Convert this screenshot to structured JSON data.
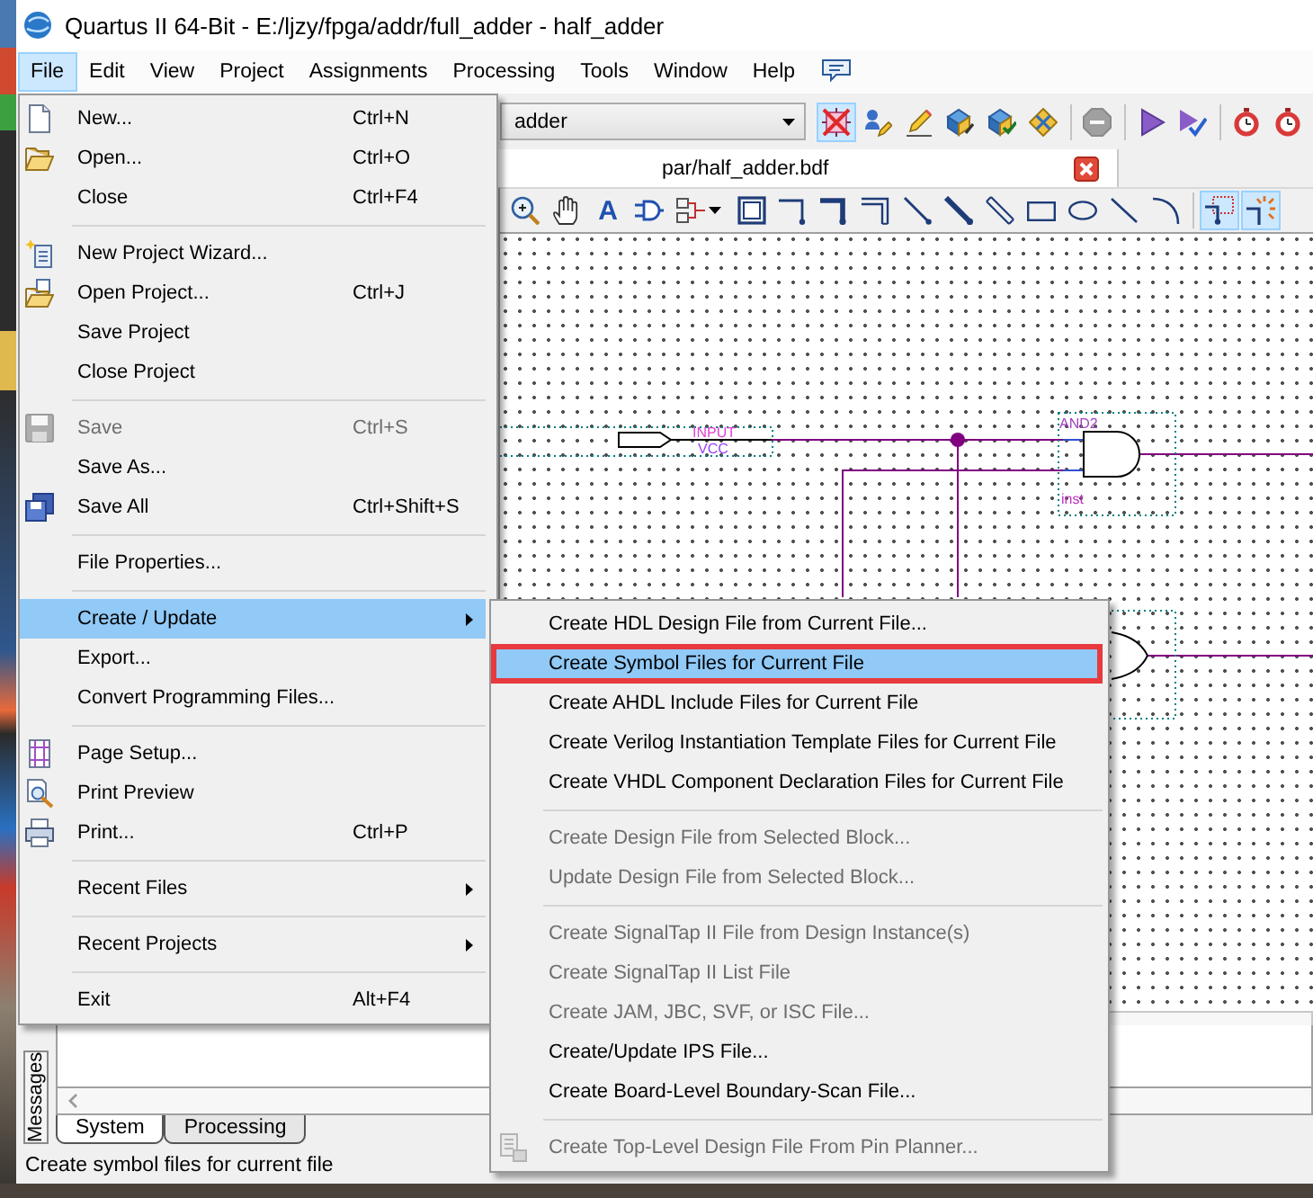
{
  "window": {
    "title": "Quartus II 64-Bit - E:/ljzy/fpga/addr/full_adder - half_adder"
  },
  "menu_bar": [
    {
      "label": "File",
      "selected": true
    },
    {
      "label": "Edit",
      "selected": false
    },
    {
      "label": "View",
      "selected": false
    },
    {
      "label": "Project",
      "selected": false
    },
    {
      "label": "Assignments",
      "selected": false
    },
    {
      "label": "Processing",
      "selected": false
    },
    {
      "label": "Tools",
      "selected": false
    },
    {
      "label": "Window",
      "selected": false
    },
    {
      "label": "Help",
      "selected": false
    }
  ],
  "main_toolbar": {
    "project_dropdown": {
      "value": "adder"
    },
    "buttons": [
      {
        "pressed": true,
        "disabled": false
      },
      {
        "pressed": false,
        "disabled": false
      },
      {
        "pressed": false,
        "disabled": false
      },
      {
        "pressed": false,
        "disabled": false
      },
      {
        "pressed": false,
        "disabled": false
      },
      {
        "pressed": false,
        "disabled": false
      },
      {
        "pressed": false,
        "disabled": true
      },
      {
        "pressed": false,
        "disabled": false
      },
      {
        "pressed": false,
        "disabled": false
      },
      {
        "pressed": false,
        "disabled": false
      },
      {
        "pressed": false,
        "disabled": false
      }
    ]
  },
  "document_tabs": [
    {
      "label": "par/half_adder.bdf",
      "selected": true
    }
  ],
  "block_toolbar": {
    "tools": [
      {
        "pressed": false
      },
      {
        "pressed": false
      },
      {
        "label": "A",
        "pressed": false
      },
      {
        "pressed": false
      },
      {
        "pressed": false
      },
      {
        "pressed": false
      },
      {
        "pressed": false
      },
      {
        "pressed": false
      },
      {
        "pressed": false
      },
      {
        "pressed": false
      },
      {
        "pressed": false
      },
      {
        "pressed": false
      },
      {
        "pressed": false
      },
      {
        "pressed": false
      },
      {
        "pressed": false
      },
      {
        "pressed": false
      },
      {
        "pressed": true
      },
      {
        "pressed": true
      }
    ]
  },
  "schematic": {
    "input_pin": {
      "type": "INPUT",
      "name": "VCC"
    },
    "gate": {
      "type": "AND2",
      "instance": "inst"
    }
  },
  "messages_panel": {
    "title": "Messages",
    "tabs": [
      {
        "label": "System",
        "selected": true
      },
      {
        "label": "Processing",
        "selected": false
      }
    ]
  },
  "status_bar": {
    "text": "Create symbol files for current file"
  },
  "file_menu": {
    "items": [
      {
        "kind": "item",
        "label": "New...",
        "shortcut": "Ctrl+N",
        "disabled": false,
        "selected": false,
        "has_submenu": false
      },
      {
        "kind": "item",
        "label": "Open...",
        "shortcut": "Ctrl+O",
        "disabled": false,
        "selected": false,
        "has_submenu": false
      },
      {
        "kind": "item",
        "label": "Close",
        "shortcut": "Ctrl+F4",
        "disabled": false,
        "selected": false,
        "has_submenu": false
      },
      {
        "kind": "separator"
      },
      {
        "kind": "item",
        "label": "New Project Wizard...",
        "disabled": false,
        "selected": false,
        "has_submenu": false
      },
      {
        "kind": "item",
        "label": "Open Project...",
        "shortcut": "Ctrl+J",
        "disabled": false,
        "selected": false,
        "has_submenu": false
      },
      {
        "kind": "item",
        "label": "Save Project",
        "disabled": false,
        "selected": false,
        "has_submenu": false
      },
      {
        "kind": "item",
        "label": "Close Project",
        "disabled": false,
        "selected": false,
        "has_submenu": false
      },
      {
        "kind": "separator"
      },
      {
        "kind": "item",
        "label": "Save",
        "shortcut": "Ctrl+S",
        "disabled": true,
        "selected": false,
        "has_submenu": false
      },
      {
        "kind": "item",
        "label": "Save As...",
        "disabled": false,
        "selected": false,
        "has_submenu": false
      },
      {
        "kind": "item",
        "label": "Save All",
        "shortcut": "Ctrl+Shift+S",
        "disabled": false,
        "selected": false,
        "has_submenu": false
      },
      {
        "kind": "separator"
      },
      {
        "kind": "item",
        "label": "File Properties...",
        "disabled": false,
        "selected": false,
        "has_submenu": false
      },
      {
        "kind": "separator"
      },
      {
        "kind": "item",
        "label": "Create / Update",
        "disabled": false,
        "selected": true,
        "has_submenu": true
      },
      {
        "kind": "item",
        "label": "Export...",
        "disabled": false,
        "selected": false,
        "has_submenu": false
      },
      {
        "kind": "item",
        "label": "Convert Programming Files...",
        "disabled": false,
        "selected": false,
        "has_submenu": false
      },
      {
        "kind": "separator"
      },
      {
        "kind": "item",
        "label": "Page Setup...",
        "disabled": false,
        "selected": false,
        "has_submenu": false
      },
      {
        "kind": "item",
        "label": "Print Preview",
        "disabled": false,
        "selected": false,
        "has_submenu": false
      },
      {
        "kind": "item",
        "label": "Print...",
        "shortcut": "Ctrl+P",
        "disabled": false,
        "selected": false,
        "has_submenu": false
      },
      {
        "kind": "separator"
      },
      {
        "kind": "item",
        "label": "Recent Files",
        "disabled": false,
        "selected": false,
        "has_submenu": true
      },
      {
        "kind": "separator"
      },
      {
        "kind": "item",
        "label": "Recent Projects",
        "disabled": false,
        "selected": false,
        "has_submenu": true
      },
      {
        "kind": "separator"
      },
      {
        "kind": "item",
        "label": "Exit",
        "shortcut": "Alt+F4",
        "disabled": false,
        "selected": false,
        "has_submenu": false
      }
    ]
  },
  "create_update_submenu": {
    "items": [
      {
        "kind": "item",
        "label": "Create HDL Design File from Current File...",
        "disabled": false,
        "selected": false,
        "annotated": false
      },
      {
        "kind": "item",
        "label": "Create Symbol Files for Current File",
        "disabled": false,
        "selected": true,
        "annotated": true
      },
      {
        "kind": "item",
        "label": "Create AHDL Include Files for Current File",
        "disabled": false,
        "selected": false,
        "annotated": false
      },
      {
        "kind": "item",
        "label": "Create Verilog Instantiation Template Files for Current File",
        "disabled": false,
        "selected": false,
        "annotated": false
      },
      {
        "kind": "item",
        "label": "Create VHDL Component Declaration Files for Current File",
        "disabled": false,
        "selected": false,
        "annotated": false
      },
      {
        "kind": "separator"
      },
      {
        "kind": "item",
        "label": "Create Design File from Selected Block...",
        "disabled": true,
        "selected": false,
        "annotated": false
      },
      {
        "kind": "item",
        "label": "Update Design File from Selected Block...",
        "disabled": true,
        "selected": false,
        "annotated": false
      },
      {
        "kind": "separator"
      },
      {
        "kind": "item",
        "label": "Create SignalTap II File from Design Instance(s)",
        "disabled": true,
        "selected": false,
        "annotated": false
      },
      {
        "kind": "item",
        "label": "Create SignalTap II List File",
        "disabled": true,
        "selected": false,
        "annotated": false
      },
      {
        "kind": "item",
        "label": "Create JAM, JBC, SVF, or ISC File...",
        "disabled": true,
        "selected": false,
        "annotated": false
      },
      {
        "kind": "item",
        "label": "Create/Update IPS File...",
        "disabled": false,
        "selected": false,
        "annotated": false
      },
      {
        "kind": "item",
        "label": "Create Board-Level Boundary-Scan File...",
        "disabled": false,
        "selected": false,
        "annotated": false
      },
      {
        "kind": "separator"
      },
      {
        "kind": "item",
        "label": "Create Top-Level Design File From Pin Planner...",
        "disabled": true,
        "selected": false,
        "annotated": false
      }
    ]
  }
}
